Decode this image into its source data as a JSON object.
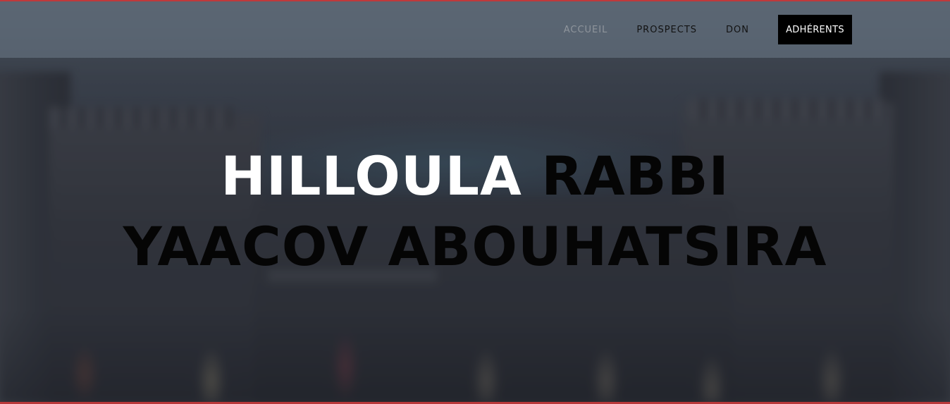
{
  "nav": {
    "items": [
      {
        "label": "ACCUEIL",
        "active": true
      },
      {
        "label": "PROSPECTS",
        "active": false
      },
      {
        "label": "DON",
        "active": false
      }
    ],
    "cta_label": "ADHÉRENTS"
  },
  "hero": {
    "title_highlight": "HILLOULA",
    "title_line1_rest": "RABBI",
    "title_line2": "YAACOV ABOUHATSIRA"
  },
  "colors": {
    "accent_border": "#c0393b",
    "header_bg": "#6e7c8a",
    "nav_active": "#8f959c",
    "nav_text": "#121212",
    "cta_bg": "#000000",
    "title_light": "#ffffff",
    "title_dark": "#050505"
  }
}
